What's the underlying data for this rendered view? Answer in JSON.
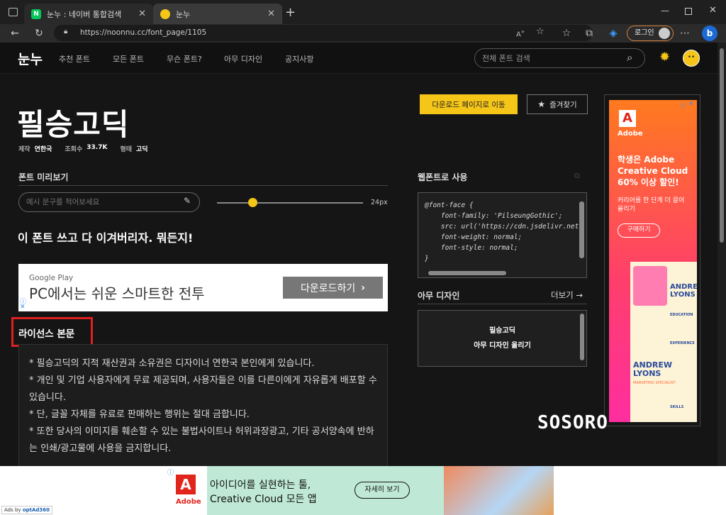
{
  "browser": {
    "tabs": [
      {
        "title": "눈누 : 네이버 통합검색",
        "favicon": "N"
      },
      {
        "title": "눈누",
        "favicon": "duck"
      }
    ],
    "url": "https://noonnu.cc/font_page/1105",
    "login_label": "로그인"
  },
  "site": {
    "logo": "눈누",
    "nav": [
      "추천 폰트",
      "모든 폰트",
      "무슨 폰트?",
      "아무 디자인",
      "공지사항"
    ],
    "search_placeholder": "전체 폰트 검색",
    "font_title": "필승고딕",
    "meta": {
      "maker_label": "제작",
      "maker_value": "연한국",
      "views_label": "조회수",
      "views_value": "33.7K",
      "style_label": "형태",
      "style_value": "고딕"
    },
    "download_label": "다운로드 페이지로 이동",
    "favorite_label": "즐겨찾기",
    "preview": {
      "heading": "폰트 미리보기",
      "placeholder": "예시 문구를 적어보세요",
      "size": "24px",
      "sample": "이 폰트 쓰고 다 이겨버리자. 뭐든지!"
    },
    "webfont": {
      "heading": "웹폰트로 사용",
      "code": "@font-face {\n    font-family: 'PilseungGothic';\n    src: url('https://cdn.jsdelivr.net\n    font-weight: normal;\n    font-style: normal;\n}"
    },
    "any_design": {
      "heading": "아무 디자인",
      "more": "더보기 →",
      "line1": "필승고딕",
      "line2": "아무 디자인 올리기"
    },
    "license": {
      "heading": "라이선스 본문",
      "lines": [
        "* 필승고딕의 지적 재산권과 소유권은 디자이너 연한국 본인에게 있습니다.",
        "* 개인 및 기업 사용자에게 무료 제공되며, 사용자들은 이를 다른이에게 자유롭게 배포할 수 있습니다.",
        "* 단, 글꼴 자체를 유료로 판매하는 행위는 절대 금합니다.",
        "* 또한 당사의 이미지를 훼손할 수 있는 불법사이트나 허위과장광고, 기타 공서양속에 반하는 인쇄/광고물에 사용을 금지합니다."
      ]
    },
    "ad_google": {
      "brand": "Google Play",
      "text": "PC에서는 쉬운 스마트한 전투",
      "cta": "다운로드하기"
    },
    "ad_adobe_side": {
      "brand": "Adobe",
      "headline": "학생은 Adobe Creative Cloud 60% 이상 할인!",
      "sub": "커리어를 한 단계 더 끌어올리기",
      "cta": "구매하기",
      "card_name": "ANDREW LYONS",
      "card_title": "MARKETING SPECIALIST",
      "card_sections": [
        "EDUCATION",
        "EXPERIENCE",
        "SKILLS"
      ]
    },
    "watermark": "SOSORO",
    "ad_bottom": {
      "brand": "Adobe",
      "line1": "아이디어를 실현하는 툴,",
      "line2": "Creative Cloud 모든 앱",
      "cta": "자세히 보기",
      "ads_by": "Ads by",
      "ads_vendor": "optAd360"
    }
  },
  "colors": {
    "accent": "#f5c518",
    "highlight": "#e02020",
    "adobe_red": "#e1251b"
  }
}
